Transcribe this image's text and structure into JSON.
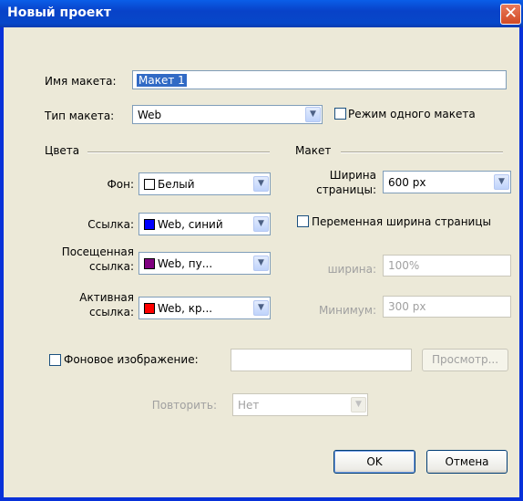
{
  "window": {
    "title": "Новый проект",
    "close_glyph": "✕"
  },
  "layout_name": {
    "label": "Имя макета:",
    "value": "Макет 1"
  },
  "layout_type": {
    "label": "Тип макета:",
    "value": "Web"
  },
  "single_layout_mode": {
    "label": "Режим одного макета",
    "checked": false
  },
  "colors_section": {
    "title": "Цвета",
    "background": {
      "label": "Фон:",
      "value": "Белый",
      "color": "#ffffff"
    },
    "link": {
      "label": "Ссылка:",
      "value": "Web, синий",
      "color": "#0000ff"
    },
    "visited_link": {
      "label_line1": "Посещенная",
      "label_line2": "ссылка:",
      "value": "Web, пу...",
      "color": "#800080"
    },
    "active_link": {
      "label_line1": "Активная",
      "label_line2": "ссылка:",
      "value": "Web, кр...",
      "color": "#ff0000"
    }
  },
  "layout_section": {
    "title": "Макет",
    "page_width": {
      "label_line1": "Ширина",
      "label_line2": "страницы:",
      "value": "600 px"
    },
    "variable_width": {
      "label": "Переменная ширина страницы",
      "checked": false
    },
    "width": {
      "label": "ширина:",
      "value": "100%"
    },
    "minimum": {
      "label": "Минимум:",
      "value": "300 px"
    }
  },
  "background_image": {
    "label": "Фоновое изображение:",
    "checked": false,
    "value": "",
    "browse_label": "Просмотр..."
  },
  "repeat": {
    "label": "Повторить:",
    "value": "Нет"
  },
  "buttons": {
    "ok": "OK",
    "cancel": "Отмена"
  },
  "colors": {
    "title_bar": "#0842c8",
    "window_bg": "#ece9d8",
    "close_button": "#d24a24",
    "disabled_text": "#a0a0a0"
  }
}
